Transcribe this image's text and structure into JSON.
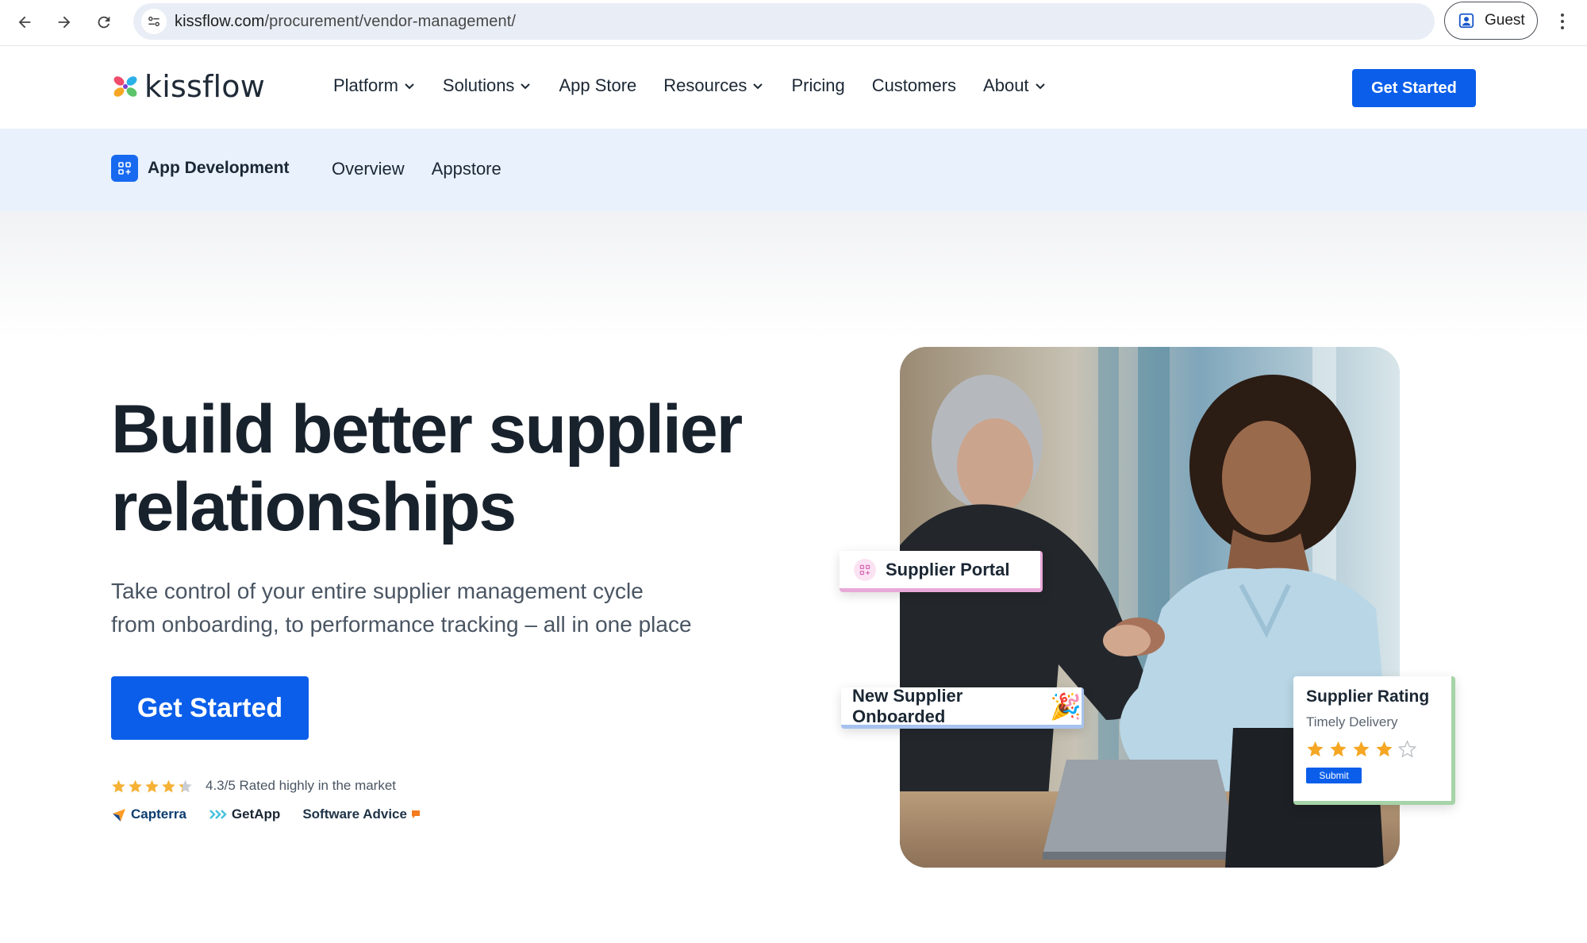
{
  "browser": {
    "url_host": "kissflow.com",
    "url_path": "/procurement/vendor-management/",
    "profile_label": "Guest",
    "icons": [
      "back-arrow-icon",
      "forward-arrow-icon",
      "reload-icon",
      "site-settings-icon",
      "profile-icon",
      "more-vert-icon"
    ]
  },
  "header": {
    "logo_text": "kissflow",
    "nav": [
      {
        "label": "Platform",
        "has_dropdown": true
      },
      {
        "label": "Solutions",
        "has_dropdown": true
      },
      {
        "label": "App Store",
        "has_dropdown": false
      },
      {
        "label": "Resources",
        "has_dropdown": true
      },
      {
        "label": "Pricing",
        "has_dropdown": false
      },
      {
        "label": "Customers",
        "has_dropdown": false
      },
      {
        "label": "About",
        "has_dropdown": true
      }
    ],
    "cta_label": "Get Started"
  },
  "subnav": {
    "brand_label": "App Development",
    "links": [
      "Overview",
      "Appstore"
    ]
  },
  "hero": {
    "title_line1": "Build better supplier",
    "title_line2": "relationships",
    "subtitle_line1": "Take control of your entire supplier management cycle",
    "subtitle_line2": "from onboarding, to performance tracking – all in one place",
    "cta_label": "Get Started",
    "rating_stars": 4.3,
    "rating_text": "4.3/5 Rated highly in the market",
    "review_sites": [
      "Capterra",
      "GetApp",
      "Software Advice"
    ]
  },
  "visual": {
    "portal_card_label": "Supplier Portal",
    "onboard_card_label": "New Supplier Onboarded",
    "onboard_emoji": "🎉",
    "rating_card": {
      "title": "Supplier Rating",
      "criterion": "Timely Delivery",
      "stars_filled": 4,
      "stars_total": 5,
      "submit_label": "Submit"
    }
  },
  "colors": {
    "brand_blue": "#0a5eea",
    "subnav_bg": "#e8f1fc",
    "star_gold": "#f5a623",
    "heading": "#18222d"
  }
}
